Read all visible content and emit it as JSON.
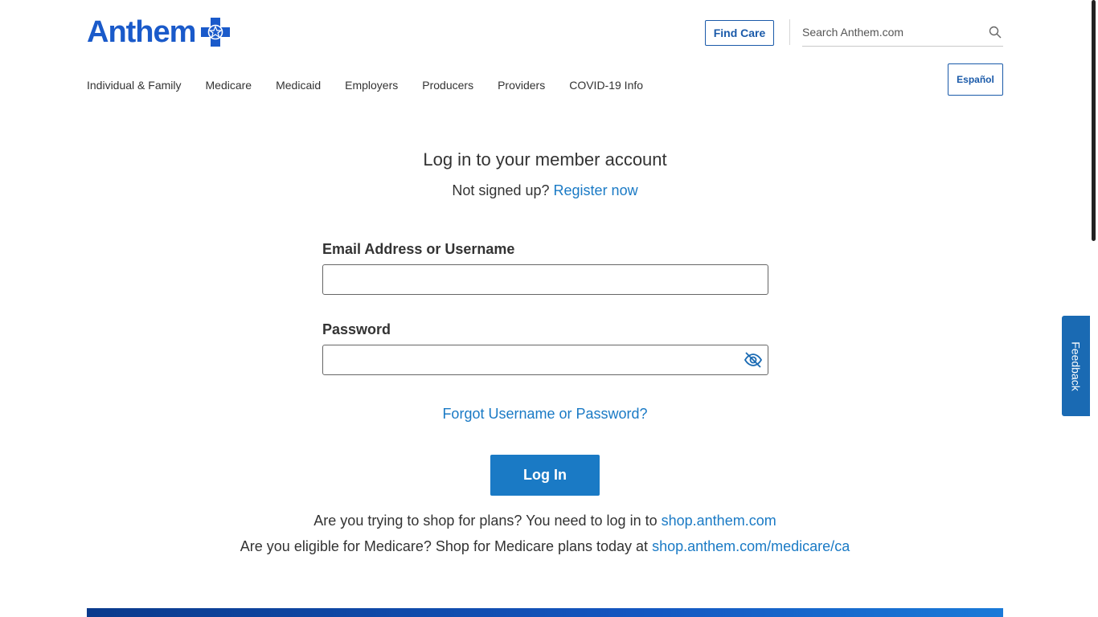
{
  "header": {
    "logo_text": "Anthem",
    "find_care_label": "Find Care",
    "search_placeholder": "Search Anthem.com",
    "espanol_label": "Español"
  },
  "nav": {
    "items": [
      {
        "label": "Individual & Family"
      },
      {
        "label": "Medicare"
      },
      {
        "label": "Medicaid"
      },
      {
        "label": "Employers"
      },
      {
        "label": "Producers"
      },
      {
        "label": "Providers"
      },
      {
        "label": "COVID-19 Info"
      }
    ]
  },
  "login": {
    "title": "Log in to your member account",
    "not_signed_up": "Not signed up?",
    "register_link": "Register now",
    "email_label": "Email Address or Username",
    "email_value": "",
    "password_label": "Password",
    "password_value": "",
    "forgot_link": "Forgot Username or Password?",
    "login_button": "Log In"
  },
  "shop": {
    "line1_text": "Are you trying to shop for plans? You need to log in to",
    "line1_link": "shop.anthem.com",
    "line2_text": "Are you eligible for Medicare? Shop for Medicare plans today at",
    "line2_link": "shop.anthem.com/medicare/ca"
  },
  "feedback": {
    "label": "Feedback"
  },
  "colors": {
    "brand_blue": "#1a5aca",
    "link_blue": "#1a7ac5",
    "button_blue": "#1a7ac5",
    "feedback_blue": "#1a6ab3"
  }
}
